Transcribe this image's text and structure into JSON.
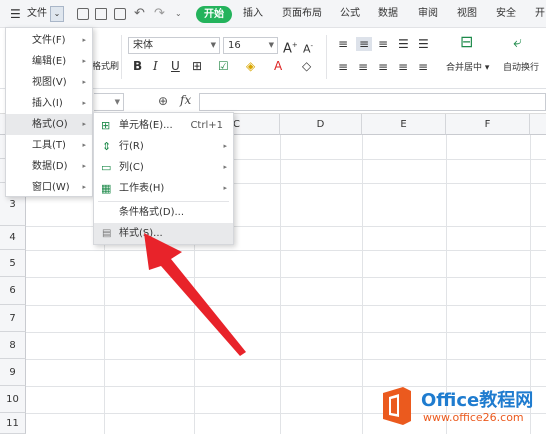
{
  "menubar": {
    "menu_label": "文件",
    "start_tab": "开始",
    "tabs": [
      "插入",
      "页面布局",
      "公式",
      "数据",
      "审阅",
      "视图",
      "安全",
      "开"
    ]
  },
  "ribbon": {
    "format_painter_label": "格式刷",
    "font_name": "宋体",
    "font_size": "16",
    "merge_center_label": "合并居中",
    "wrap_text_label": "自动换行"
  },
  "formula_bar": {
    "fx_label": "fx"
  },
  "sheet": {
    "columns": [
      "C",
      "D",
      "E",
      "F"
    ],
    "rows": [
      "3",
      "4",
      "5",
      "6",
      "7",
      "8",
      "9",
      "10",
      "11"
    ]
  },
  "main_menu": {
    "items": [
      {
        "label": "文件(F)"
      },
      {
        "label": "编辑(E)"
      },
      {
        "label": "视图(V)"
      },
      {
        "label": "插入(I)"
      },
      {
        "label": "格式(O)"
      },
      {
        "label": "工具(T)"
      },
      {
        "label": "数据(D)"
      },
      {
        "label": "窗口(W)"
      }
    ]
  },
  "format_submenu": {
    "items": [
      {
        "label": "单元格(E)...",
        "shortcut": "Ctrl+1"
      },
      {
        "label": "行(R)"
      },
      {
        "label": "列(C)"
      },
      {
        "label": "工作表(H)"
      },
      {
        "label": "条件格式(D)..."
      },
      {
        "label": "样式(S)..."
      }
    ]
  },
  "watermark": {
    "title": "Office教程网",
    "url": "www.office26.com"
  },
  "colors": {
    "accent_green": "#24b35c",
    "arrow_red": "#e8232a",
    "logo_orange": "#eb5a1e",
    "logo_blue": "#1f7ccf"
  }
}
